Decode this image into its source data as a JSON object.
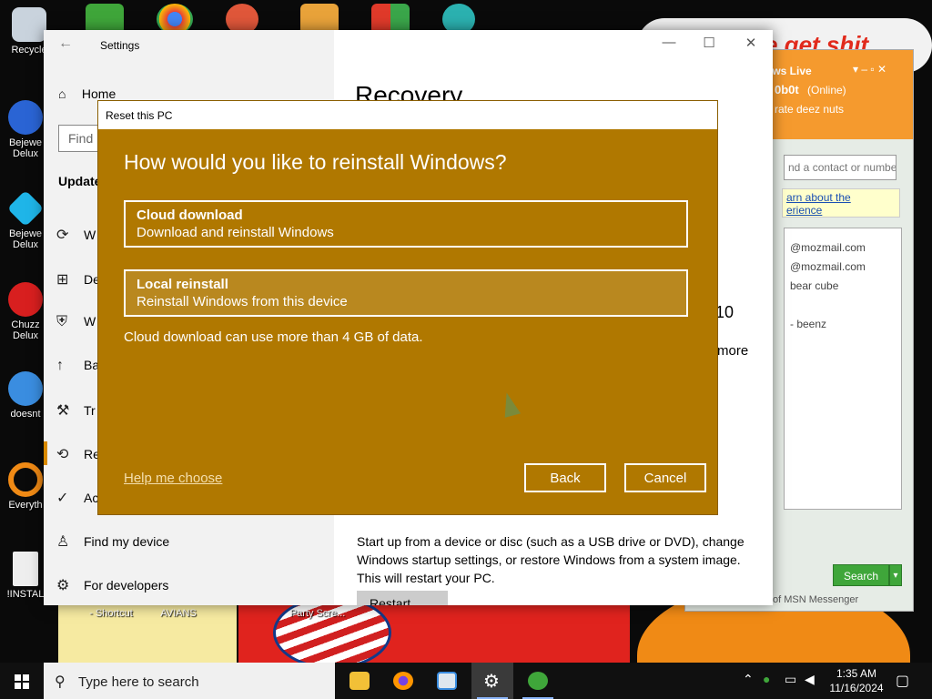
{
  "desktop": {
    "wallpaper_text": "e get shit",
    "icons": [
      {
        "label": "Recycle"
      },
      {
        "label": "Bejewe Delux"
      },
      {
        "label": "Bejewe Delux"
      },
      {
        "label": "Chuzz Delux"
      },
      {
        "label": "doesnt"
      },
      {
        "label": "Everyth"
      },
      {
        "label": "!INSTAL"
      }
    ],
    "bottom_labels": [
      "- Shortcut",
      "AVIANS",
      "Party Scre..."
    ]
  },
  "settings": {
    "window_title": "Settings",
    "controls": {
      "minimize": "—",
      "maximize": "☐",
      "close": "✕"
    },
    "home_label": "Home",
    "find_placeholder": "Find",
    "section_heading": "Update",
    "items": [
      {
        "label": "W",
        "icon": "sync-icon"
      },
      {
        "label": "De",
        "icon": "delivery-icon"
      },
      {
        "label": "W",
        "icon": "shield-icon"
      },
      {
        "label": "Ba",
        "icon": "backup-icon"
      },
      {
        "label": "Tr",
        "icon": "wrench-icon"
      },
      {
        "label": "Re",
        "icon": "recovery-icon"
      },
      {
        "label": "Ac",
        "icon": "activation-icon"
      },
      {
        "label": "Find my device",
        "icon": "person-pin-icon"
      },
      {
        "label": "For developers",
        "icon": "developer-icon"
      }
    ],
    "page_title": "Recovery",
    "fragments": {
      "version": "10",
      "more": "more"
    },
    "advanced_description": "Start up from a device or disc (such as a USB drive or DVD), change Windows startup settings, or restore Windows from a system image. This will restart your PC.",
    "restart_button": "Restart now"
  },
  "messenger": {
    "header_title": "ows Live",
    "user": "0b0t",
    "status": "(Online)",
    "personal_message": "rate deez nuts",
    "search_placeholder": "nd a contact or numbe",
    "tip_line1": "arn about the",
    "tip_line2": "erience",
    "contacts": [
      "@mozmail.com",
      "@mozmail.com",
      "bear cube",
      "- beenz"
    ],
    "search_button": "Search",
    "footer": "of MSN Messenger"
  },
  "dialog": {
    "title": "Reset this PC",
    "heading": "How would you like to reinstall Windows?",
    "options": [
      {
        "title": "Cloud download",
        "desc": "Download and reinstall Windows"
      },
      {
        "title": "Local reinstall",
        "desc": "Reinstall Windows from this device"
      }
    ],
    "note": "Cloud download can use more than 4 GB of data.",
    "help_link": "Help me choose",
    "back_button": "Back",
    "cancel_button": "Cancel",
    "accent_color": "#b07800"
  },
  "taskbar": {
    "search_placeholder": "Type here to search",
    "time": "1:35 AM",
    "date": "11/16/2024",
    "apps": [
      {
        "name": "file-explorer-icon"
      },
      {
        "name": "firefox-icon"
      },
      {
        "name": "news-icon"
      },
      {
        "name": "settings-icon"
      },
      {
        "name": "messenger-icon"
      }
    ]
  }
}
